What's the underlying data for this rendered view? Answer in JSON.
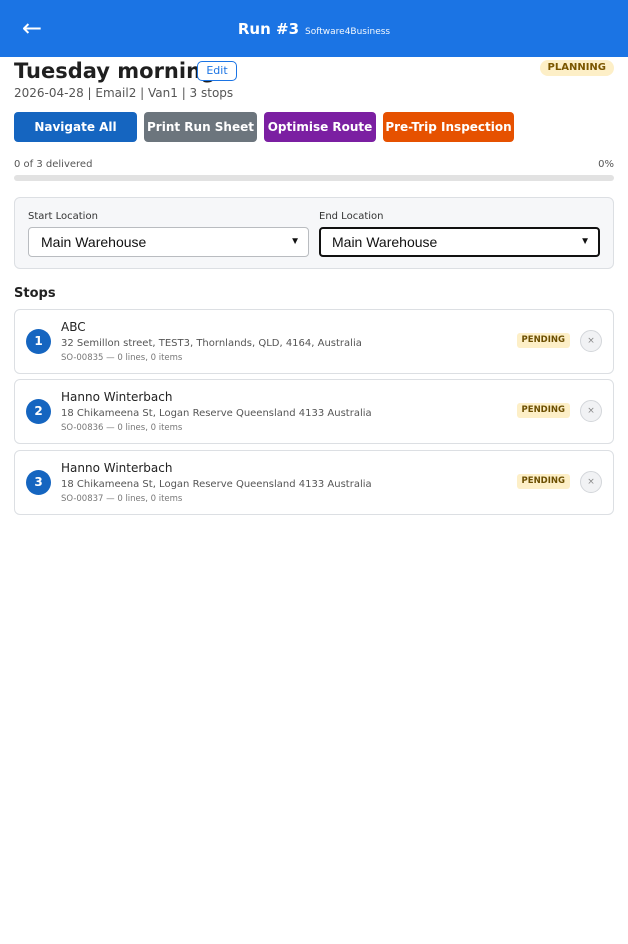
{
  "header": {
    "back_icon": "←",
    "run_title": "Run #3",
    "brand": "Software4Business"
  },
  "run": {
    "title": "Tuesday morning",
    "edit_label": "Edit",
    "status": "PLANNING",
    "meta": "2026-04-28 | Email2 | Van1 | 3 stops"
  },
  "actions": {
    "navigate_all": "Navigate All Stops",
    "print_run_sheet": "Print Run Sheet",
    "optimise_route": "Optimise Route",
    "pre_trip": "Pre-Trip Inspection"
  },
  "progress": {
    "label": "0 of 3 delivered",
    "percent_text": "0%",
    "fraction": 0
  },
  "locations": {
    "start_label": "Start Location",
    "start_value": "Main Warehouse",
    "end_label": "End Location",
    "end_value": "Main Warehouse"
  },
  "stops_heading": "Stops",
  "stops": [
    {
      "number": "1",
      "name": "ABC",
      "address": "32 Semillon street, TEST3, Thornlands, QLD, 4164, Australia",
      "order": "SO-00835 — 0 lines, 0 items",
      "status": "PENDING",
      "remove_icon": "×"
    },
    {
      "number": "2",
      "name": "Hanno Winterbach",
      "address": "18 Chikameena St, Logan Reserve Queensland 4133 Australia",
      "order": "SO-00836 — 0 lines, 0 items",
      "status": "PENDING",
      "remove_icon": "×"
    },
    {
      "number": "3",
      "name": "Hanno Winterbach",
      "address": "18 Chikameena St, Logan Reserve Queensland 4133 Australia",
      "order": "SO-00837 — 0 lines, 0 items",
      "status": "PENDING",
      "remove_icon": "×"
    }
  ],
  "colors": {
    "header": "#1b74e4",
    "navigate": "#1565c0",
    "print": "#6c757d",
    "optimise": "#7b1fa2",
    "pre_trip": "#e65100",
    "status_badge": "#fdefc7"
  }
}
